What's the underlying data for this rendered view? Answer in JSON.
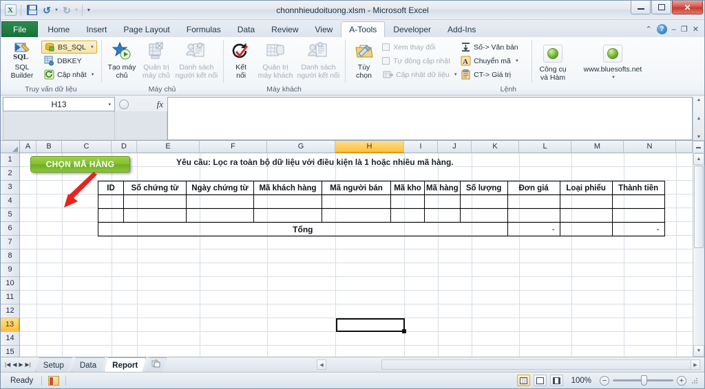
{
  "window": {
    "title": "chonnhieudoituong.xlsm  -  Microsoft Excel",
    "app_logo": "X",
    "minimize": "–",
    "restore": "▫",
    "close": "✕"
  },
  "quick_access": {
    "save": "save-icon",
    "undo": "↺",
    "redo": "↻",
    "customize": "▾"
  },
  "ribbon_tabs": [
    {
      "label": "File",
      "active": false,
      "is_file": true
    },
    {
      "label": "Home",
      "active": false
    },
    {
      "label": "Insert",
      "active": false
    },
    {
      "label": "Page Layout",
      "active": false
    },
    {
      "label": "Formulas",
      "active": false
    },
    {
      "label": "Data",
      "active": false
    },
    {
      "label": "Review",
      "active": false
    },
    {
      "label": "View",
      "active": false
    },
    {
      "label": "A-Tools",
      "active": true
    },
    {
      "label": "Developer",
      "active": false
    },
    {
      "label": "Add-Ins",
      "active": false
    }
  ],
  "ribbon_right": {
    "collapse": "⌃",
    "help": "?",
    "minimize": "–",
    "restore": "❐",
    "close": "✕"
  },
  "ribbon_groups": [
    {
      "name": "Truy vấn dữ liệu",
      "label": "Truy vấn dữ liệu",
      "big": {
        "line1": "SQL",
        "line2": "Builder",
        "icon": "sql-builder-icon"
      },
      "small": [
        {
          "label": "BS_SQL",
          "icon": "bs-sql-icon",
          "selected": true,
          "dropdown": true
        },
        {
          "label": "DBKEY",
          "icon": "dbkey-icon",
          "dropdown": false
        },
        {
          "label": "Cập nhật",
          "icon": "refresh-icon",
          "dropdown": true
        }
      ]
    },
    {
      "name": "May chu",
      "label": "Máy chủ",
      "buttons": [
        {
          "line1": "Tạo máy",
          "line2": "chủ",
          "icon": "create-server-icon",
          "disabled": false
        },
        {
          "line1": "Quản trị",
          "line2": "máy chủ",
          "icon": "manage-server-icon",
          "disabled": true
        },
        {
          "line1": "Danh sách",
          "line2": "người kết nối",
          "icon": "connection-list-icon",
          "disabled": true
        }
      ]
    },
    {
      "name": "May khach",
      "label": "Máy khách",
      "buttons": [
        {
          "line1": "Kết",
          "line2": "nối",
          "icon": "connect-icon",
          "disabled": false
        },
        {
          "line1": "Quản trị",
          "line2": "máy khách",
          "icon": "manage-client-icon",
          "disabled": true
        },
        {
          "line1": "Danh sách",
          "line2": "người kết nối",
          "icon": "client-list-icon",
          "disabled": true
        }
      ]
    },
    {
      "name": "Lenh",
      "label": "Lệnh",
      "big": {
        "line1": "Tùy",
        "line2": "chọn",
        "icon": "options-icon"
      },
      "checkboxes": [
        {
          "label": "Xem thay đổi",
          "checked": false,
          "disabled": true
        },
        {
          "label": "Tự động cập nhật",
          "checked": false,
          "disabled": true
        }
      ],
      "small": [
        {
          "label": "Cập nhật dữ liệu",
          "icon": "update-data-icon",
          "dropdown": true,
          "disabled": true
        },
        {
          "label": "Số-> Văn bản",
          "icon": "number-to-text-icon",
          "dropdown": false
        },
        {
          "label": "Chuyển mã",
          "icon": "convert-code-icon",
          "dropdown": true
        },
        {
          "label": "CT-> Giá trị",
          "icon": "formula-to-value-icon",
          "dropdown": false
        }
      ]
    },
    {
      "name": "Tools",
      "label": "",
      "buttons": [
        {
          "line1": "Công cụ",
          "line2": "và Hàm",
          "icon": "tools-functions-icon",
          "dropdown": true
        },
        {
          "line1": "www.bluesofts.net",
          "line2": "",
          "icon": "bluesofts-icon",
          "dropdown": true
        }
      ]
    }
  ],
  "formula_bar": {
    "name_box_value": "H13",
    "name_box_arrow": "▾",
    "fx_label": "fx",
    "formula_value": "",
    "formula_placeholder": ""
  },
  "grid": {
    "columns": [
      "A",
      "B",
      "C",
      "D",
      "E",
      "F",
      "G",
      "H",
      "I",
      "J",
      "K",
      "L",
      "M",
      "N"
    ],
    "selected_column": "H",
    "rows": [
      "1",
      "2",
      "3",
      "4",
      "5",
      "6",
      "7",
      "8",
      "9",
      "10",
      "11",
      "12",
      "13",
      "14",
      "15"
    ],
    "selected_row": "13",
    "selected_cell": "H13"
  },
  "sheet_content": {
    "macro_button_label": "CHỌN  MÃ HÀNG",
    "requirement_text": "Yêu cầu: Lọc ra toàn bộ dữ liệu với điều kiện là 1 hoặc nhiều mã hàng.",
    "table_headers": [
      "ID",
      "Số chứng từ",
      "Ngày chứng từ",
      "Mã khách hàng",
      "Mã người bán",
      "Mã kho",
      "Mã hàng",
      "Số lượng",
      "Đơn giá",
      "Loại phiếu",
      "Thành tiền"
    ],
    "data_rows": [
      [
        "",
        "",
        "",
        "",
        "",
        "",
        "",
        "",
        "",
        "",
        ""
      ],
      [
        "",
        "",
        "",
        "",
        "",
        "",
        "",
        "",
        "",
        "",
        ""
      ]
    ],
    "total_row": {
      "label": "Tổng",
      "unit_price": "-",
      "voucher_type": "",
      "amount": "-"
    }
  },
  "sheet_tabs": {
    "nav_first": "◀◀",
    "nav_prev": "◀",
    "nav_next": "▶",
    "nav_last": "▶▶",
    "tabs": [
      {
        "label": "Setup",
        "active": false
      },
      {
        "label": "Data",
        "active": false
      },
      {
        "label": "Report",
        "active": true
      }
    ],
    "new_sheet": "new-sheet-icon"
  },
  "status_bar": {
    "status": "Ready",
    "macro_record": "record-macro-icon",
    "views": [
      {
        "name": "normal-view",
        "active": true
      },
      {
        "name": "page-layout-view",
        "active": false
      },
      {
        "name": "page-break-view",
        "active": false
      }
    ],
    "zoom": "100%",
    "zoom_out": "−",
    "zoom_in": "+"
  },
  "colors": {
    "accent_green": "#8cc836",
    "selection_orange": "#fcbf3f",
    "file_tab_green": "#16713a",
    "arrow_red": "#e8241a"
  }
}
